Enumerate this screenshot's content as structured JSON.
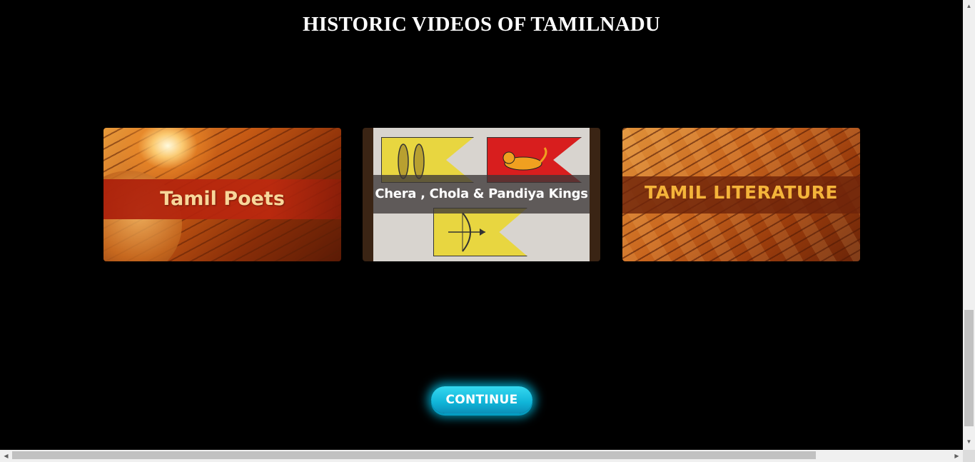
{
  "page": {
    "title": "HISTORIC VIDEOS OF TAMILNADU"
  },
  "videos": [
    {
      "label": "Tamil Poets",
      "accent": "#f8d79a"
    },
    {
      "label": "Chera , Chola & Pandiya Kings",
      "accent": "#ffffff"
    },
    {
      "label": "TAMIL LITERATURE",
      "accent": "#f4b43a"
    }
  ],
  "actions": {
    "continue_label": "CONTINUE",
    "continue_color": "#10b4d8"
  },
  "scrollbars": {
    "up_icon": "▲",
    "down_icon": "▼",
    "left_icon": "◀",
    "right_icon": "▶"
  }
}
